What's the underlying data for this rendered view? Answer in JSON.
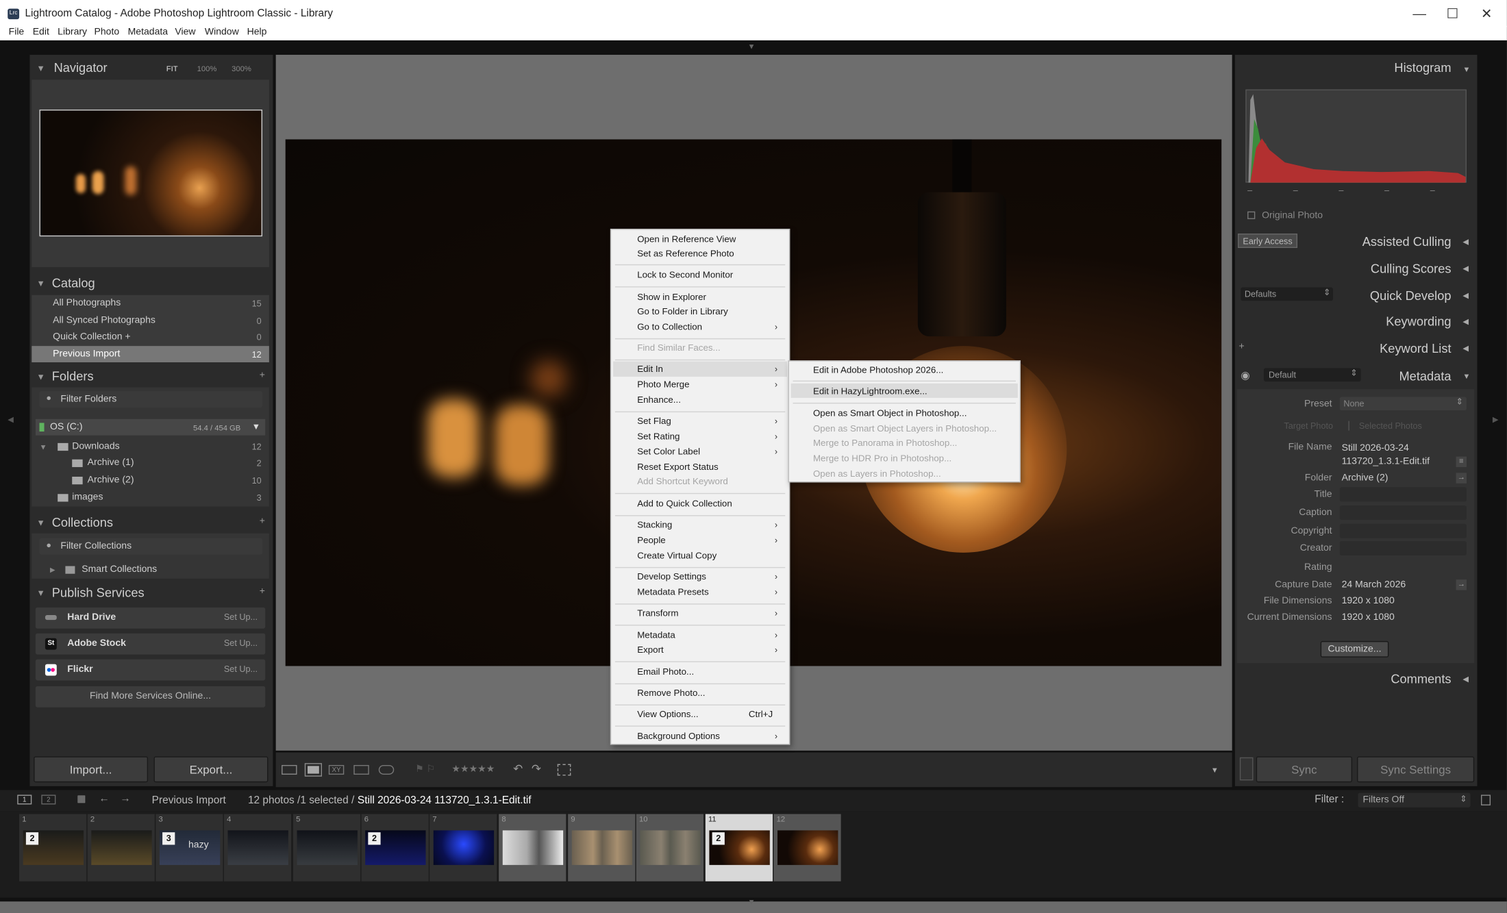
{
  "window": {
    "title": "Lightroom Catalog - Adobe Photoshop Lightroom Classic - Library",
    "app_icon": "Lrc",
    "controls": [
      "—",
      "☐",
      "✕"
    ]
  },
  "menubar": [
    "File",
    "Edit",
    "Library",
    "Photo",
    "Metadata",
    "View",
    "Window",
    "Help"
  ],
  "navigator": {
    "title": "Navigator",
    "zoom": [
      "FIT",
      "100%",
      "300%"
    ]
  },
  "catalog": {
    "title": "Catalog",
    "items": [
      {
        "label": "All Photographs",
        "count": "15"
      },
      {
        "label": "All Synced Photographs",
        "count": "0"
      },
      {
        "label": "Quick Collection +",
        "count": "0"
      },
      {
        "label": "Previous Import",
        "count": "12"
      }
    ]
  },
  "folders": {
    "title": "Folders",
    "filter": "Filter Folders",
    "volume": "OS (C:)",
    "volume_size": "54.4 / 454 GB",
    "items": [
      {
        "label": "Downloads",
        "count": "12"
      },
      {
        "label": "Archive (1)",
        "count": "2"
      },
      {
        "label": "Archive (2)",
        "count": "10"
      },
      {
        "label": "images",
        "count": "3"
      }
    ]
  },
  "collections": {
    "title": "Collections",
    "filter": "Filter Collections",
    "items": [
      "Smart Collections"
    ]
  },
  "publish": {
    "title": "Publish Services",
    "services": [
      {
        "name": "Hard Drive",
        "action": "Set Up..."
      },
      {
        "name": "Adobe Stock",
        "action": "Set Up...",
        "icon_text": "St"
      },
      {
        "name": "Flickr",
        "action": "Set Up..."
      }
    ],
    "find_more": "Find More Services Online..."
  },
  "left_buttons": {
    "import": "Import...",
    "export": "Export..."
  },
  "context_menu": {
    "items": [
      "Open in Reference View",
      "Set as Reference Photo",
      "Lock to Second Monitor",
      "Show in Explorer",
      "Go to Folder in Library",
      "Go to Collection",
      "Find Similar Faces...",
      "Edit In",
      "Photo Merge",
      "Enhance...",
      "Set Flag",
      "Set Rating",
      "Set Color Label",
      "Reset Export Status",
      "Add Shortcut Keyword",
      "Add to Quick Collection",
      "Stacking",
      "People",
      "Create Virtual Copy",
      "Develop Settings",
      "Metadata Presets",
      "Transform",
      "Metadata",
      "Export",
      "Email Photo...",
      "Remove Photo...",
      "View Options...",
      "Background Options"
    ],
    "view_options_shortcut": "Ctrl+J"
  },
  "submenu": {
    "items": [
      "Edit in Adobe Photoshop 2026...",
      "Edit in HazyLightroom.exe...",
      "Open as Smart Object in Photoshop...",
      "Open as Smart Object Layers in Photoshop...",
      "Merge to Panorama in Photoshop...",
      "Merge to HDR Pro in Photoshop...",
      "Open as Layers in Photoshop..."
    ]
  },
  "toolbar": {
    "stars": "★★★★★"
  },
  "right": {
    "histogram": "Histogram",
    "original_photo": "Original Photo",
    "early_access": "Early Access",
    "assisted_culling": "Assisted Culling",
    "culling_scores": "Culling Scores",
    "quick_develop": "Quick Develop",
    "qd_preset": "Defaults",
    "keywording": "Keywording",
    "keyword_list": "Keyword List",
    "metadata": "Metadata",
    "md_preset_view": "Default",
    "preset_label": "Preset",
    "preset_value": "None",
    "target_photo": "Target Photo",
    "selected_photos": "Selected Photos",
    "fields": [
      {
        "label": "File Name",
        "value": "Still 2026-03-24 113720_1.3.1-Edit.tif"
      },
      {
        "label": "Folder",
        "value": "Archive (2)"
      },
      {
        "label": "Title",
        "value": ""
      },
      {
        "label": "Caption",
        "value": ""
      },
      {
        "label": "Copyright",
        "value": ""
      },
      {
        "label": "Creator",
        "value": ""
      },
      {
        "label": "Rating",
        "value": ""
      },
      {
        "label": "Capture Date",
        "value": "24 March 2026"
      },
      {
        "label": "File Dimensions",
        "value": "1920 x 1080"
      },
      {
        "label": "Current Dimensions",
        "value": "1920 x 1080"
      }
    ],
    "customize": "Customize...",
    "comments": "Comments",
    "sync": "Sync",
    "sync_settings": "Sync Settings"
  },
  "filmbar": {
    "source": "Previous Import",
    "count": "12 photos /1 selected /",
    "file": "Still 2026-03-24 113720_1.3.1-Edit.tif",
    "filter_label": "Filter :",
    "filter_value": "Filters Off"
  },
  "film": [
    {
      "n": "1",
      "badge": "2"
    },
    {
      "n": "2",
      "badge": ""
    },
    {
      "n": "3",
      "badge": "3",
      "txt": "hazy"
    },
    {
      "n": "4",
      "badge": ""
    },
    {
      "n": "5",
      "badge": ""
    },
    {
      "n": "6",
      "badge": "2"
    },
    {
      "n": "7",
      "badge": ""
    },
    {
      "n": "8",
      "badge": ""
    },
    {
      "n": "9",
      "badge": ""
    },
    {
      "n": "10",
      "badge": ""
    },
    {
      "n": "11",
      "badge": "2"
    },
    {
      "n": "12",
      "badge": ""
    }
  ],
  "colors": {
    "accent": "#ffffff",
    "panel": "#2b2b2b",
    "menu": "#f1f1f1"
  }
}
